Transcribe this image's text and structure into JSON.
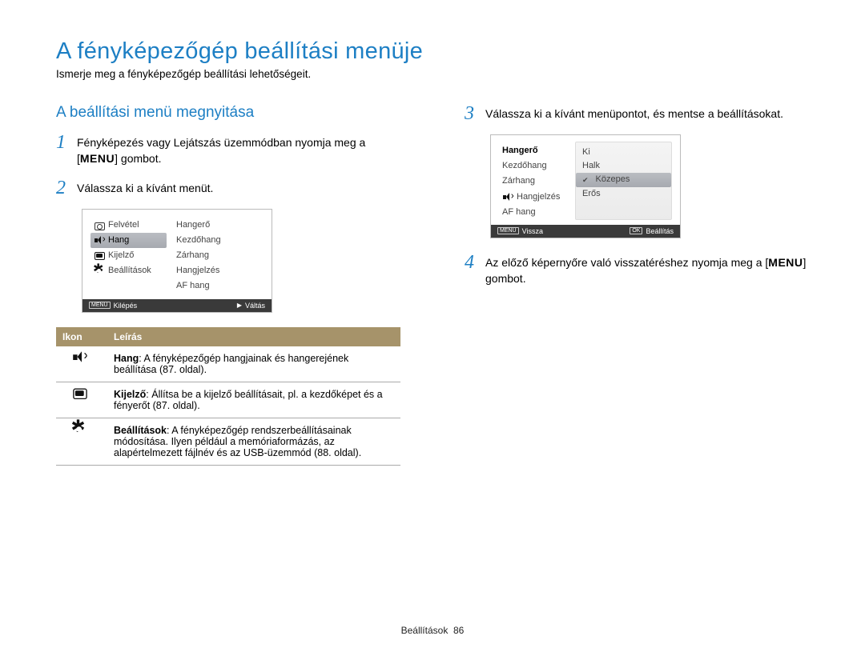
{
  "page": {
    "title": "A fényképezőgép beállítási menüje",
    "subtitle": "Ismerje meg a fényképezőgép beállítási lehetőségeit."
  },
  "section_title": "A beállítási menü megnyitása",
  "steps": {
    "s1a": "Fényképezés vagy Lejátszás üzemmódban nyomja meg a [",
    "s1b": "MENU",
    "s1c": "] gombot.",
    "s2": "Válassza ki a kívánt menüt.",
    "s3": "Válassza ki a kívánt menüpontot, és mentse a beállításokat.",
    "s4a": "Az előző képernyőre való visszatéréshez nyomja meg a [",
    "s4b": "MENU",
    "s4c": "] gombot."
  },
  "lcd1": {
    "left": [
      "Felvétel",
      "Hang",
      "Kijelző",
      "Beállítások"
    ],
    "right": [
      "Hangerő",
      "Kezdőhang",
      "Zárhang",
      "Hangjelzés",
      "AF hang"
    ],
    "footer_left_icon": "MENU",
    "footer_left": "Kilépés",
    "footer_right": "Váltás"
  },
  "lcd2": {
    "left": [
      "Hangerő",
      "Kezdőhang",
      "Zárhang",
      "Hangjelzés",
      "AF hang"
    ],
    "right": [
      "Ki",
      "Halk",
      "Közepes",
      "Erős"
    ],
    "footer_left_icon": "MENU",
    "footer_left": "Vissza",
    "footer_right_icon": "OK",
    "footer_right": "Beállítás"
  },
  "table": {
    "head_icon": "Ikon",
    "head_desc": "Leírás",
    "row1_bold": "Hang",
    "row1": ": A fényképezőgép hangjainak és hangerejének beállítása (87. oldal).",
    "row2_bold": "Kijelző",
    "row2": ": Állítsa be a kijelző beállításait, pl. a kezdőképet és a fényerőt (87. oldal).",
    "row3_bold": "Beállítások",
    "row3": ": A fényképezőgép rendszerbeállításainak módosítása. Ilyen például a memóriaformázás, az alapértelmezett fájlnév és az USB-üzemmód (88. oldal)."
  },
  "footer": {
    "section": "Beállítások",
    "page": "86"
  }
}
